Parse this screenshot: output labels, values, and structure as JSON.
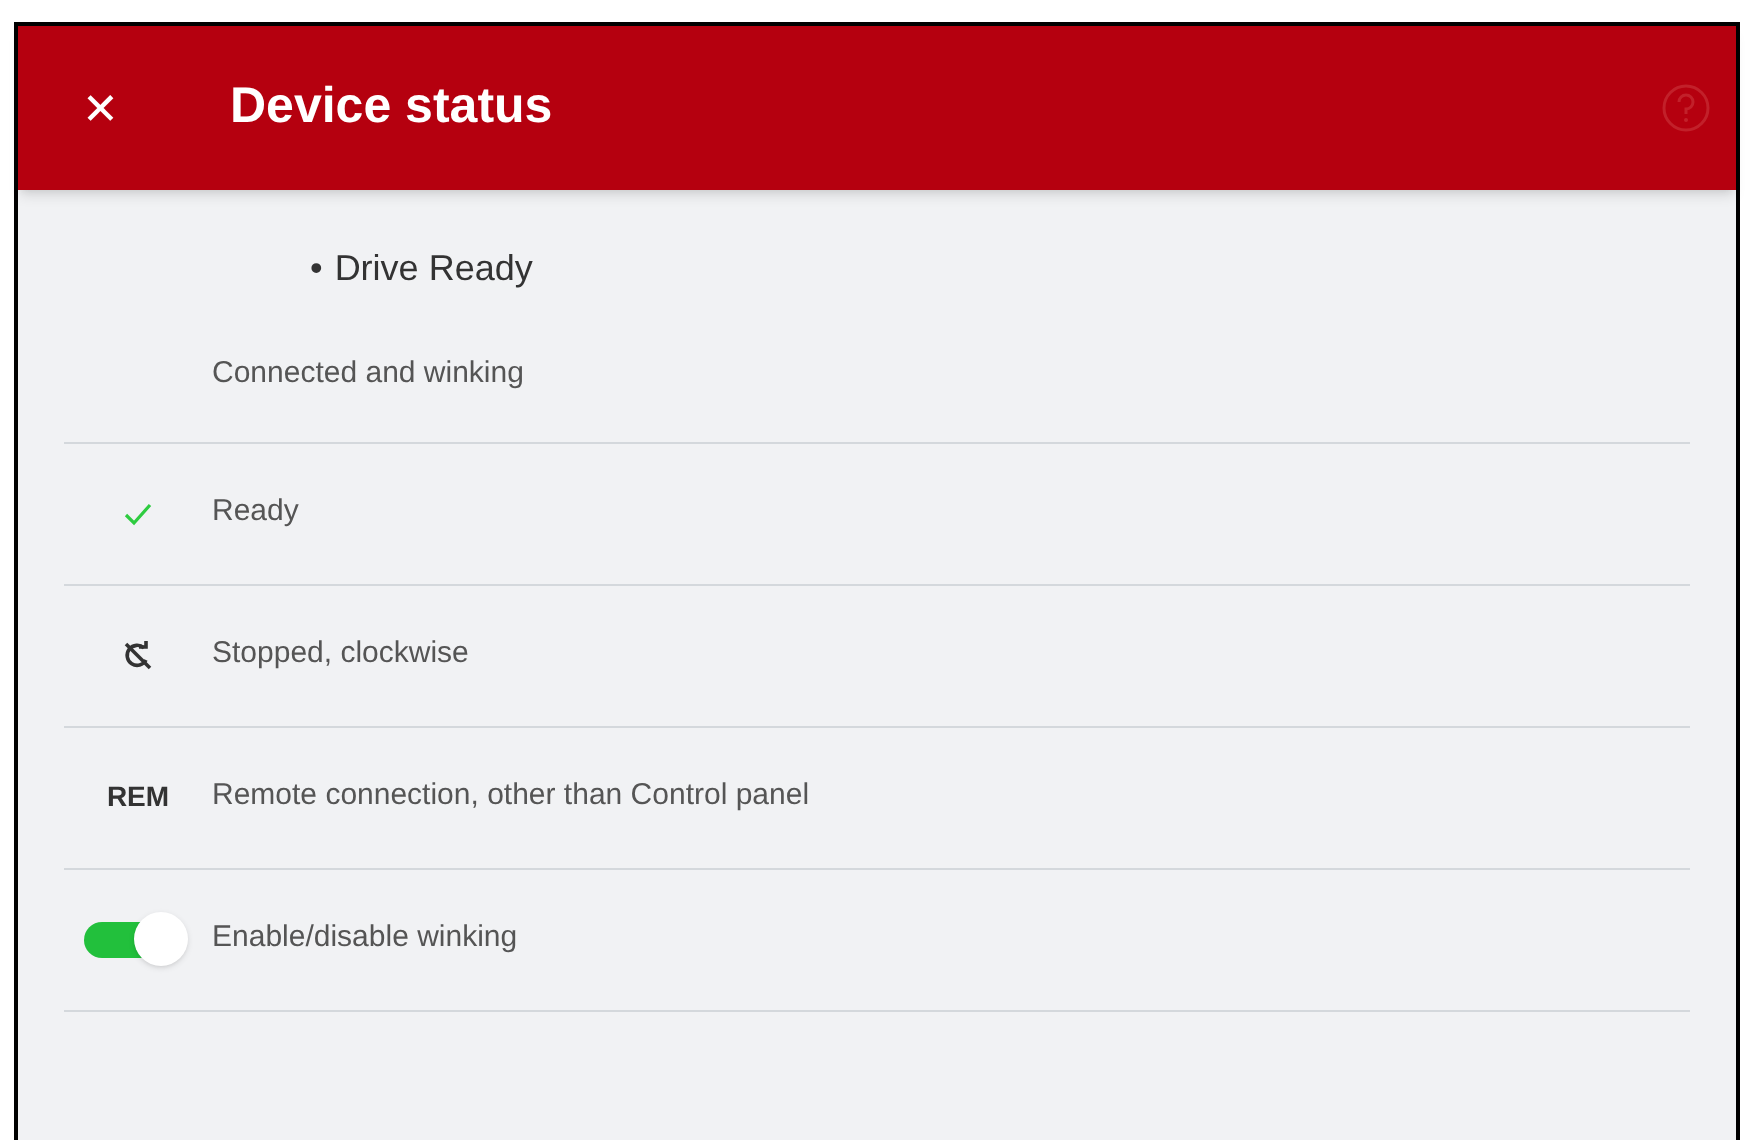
{
  "header": {
    "close": "✕",
    "title": "Device status"
  },
  "status": {
    "bullet": "•",
    "name": "Drive Ready",
    "detail": "Connected and winking"
  },
  "rows": [
    {
      "kind": "check",
      "label": "Ready"
    },
    {
      "kind": "rotation",
      "label": "Stopped, clockwise"
    },
    {
      "kind": "code",
      "code": "REM",
      "label": "Remote connection, other than Control panel"
    },
    {
      "kind": "toggle",
      "on": true,
      "label": "Enable/disable winking"
    }
  ]
}
